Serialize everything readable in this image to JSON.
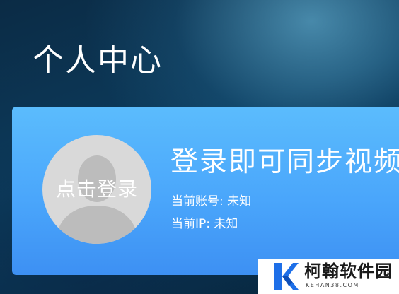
{
  "page": {
    "title": "个人中心"
  },
  "user_card": {
    "avatar_label": "点击登录",
    "login_prompt": "登录即可同步视频",
    "account_label": "当前账号:",
    "account_value": "未知",
    "ip_label": "当前IP:",
    "ip_value": "未知"
  },
  "watermark": {
    "name": "柯翰软件园",
    "url": "KEHAN38.COM",
    "logo_icon": "k-logo-icon"
  },
  "colors": {
    "card_top": "#5bbcfd",
    "card_bottom": "#3d90f3",
    "avatar_bg": "#d9d9d9",
    "avatar_silhouette": "#bcbcbc",
    "logo_blue": "#1e6fe8"
  }
}
